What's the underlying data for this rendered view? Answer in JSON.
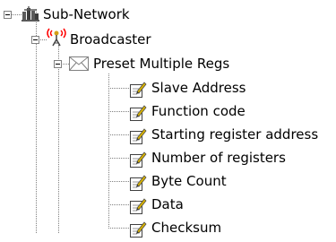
{
  "tree": {
    "root": {
      "label": "Sub-Network",
      "icon": "network-icon",
      "expanded": true
    },
    "broadcaster": {
      "label": "Broadcaster",
      "icon": "antenna-icon",
      "expanded": true
    },
    "preset": {
      "label": "Preset Multiple Regs",
      "icon": "envelope-icon",
      "expanded": true
    },
    "fields": [
      {
        "label": "Slave Address",
        "icon": "edit-field-icon"
      },
      {
        "label": "Function code",
        "icon": "edit-field-icon"
      },
      {
        "label": "Starting register address",
        "icon": "edit-field-icon"
      },
      {
        "label": "Number of registers",
        "icon": "edit-field-icon"
      },
      {
        "label": "Byte Count",
        "icon": "edit-field-icon"
      },
      {
        "label": "Data",
        "icon": "edit-field-icon"
      },
      {
        "label": "Checksum",
        "icon": "edit-field-icon"
      }
    ]
  },
  "colors": {
    "background": "#ffffff",
    "text": "#000000",
    "tree_line": "#808080",
    "network_icon": "#5a5a5a",
    "antenna_waves": "#ff0000",
    "antenna_tip": "#d4a017",
    "edit_field_pencil": "#d6b000"
  }
}
